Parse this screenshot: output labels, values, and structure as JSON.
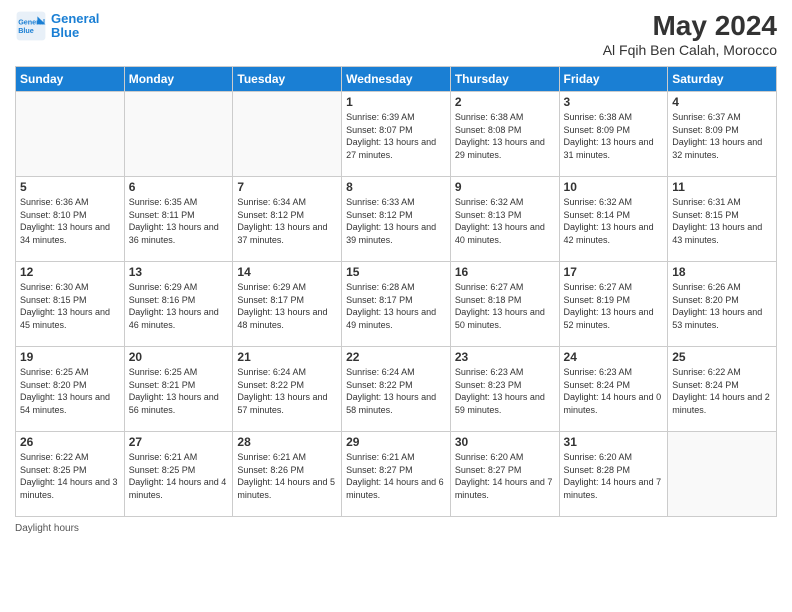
{
  "header": {
    "logo_line1": "General",
    "logo_line2": "Blue",
    "month_year": "May 2024",
    "location": "Al Fqih Ben Calah, Morocco"
  },
  "weekdays": [
    "Sunday",
    "Monday",
    "Tuesday",
    "Wednesday",
    "Thursday",
    "Friday",
    "Saturday"
  ],
  "weeks": [
    [
      {
        "day": "",
        "info": ""
      },
      {
        "day": "",
        "info": ""
      },
      {
        "day": "",
        "info": ""
      },
      {
        "day": "1",
        "info": "Sunrise: 6:39 AM\nSunset: 8:07 PM\nDaylight: 13 hours\nand 27 minutes."
      },
      {
        "day": "2",
        "info": "Sunrise: 6:38 AM\nSunset: 8:08 PM\nDaylight: 13 hours\nand 29 minutes."
      },
      {
        "day": "3",
        "info": "Sunrise: 6:38 AM\nSunset: 8:09 PM\nDaylight: 13 hours\nand 31 minutes."
      },
      {
        "day": "4",
        "info": "Sunrise: 6:37 AM\nSunset: 8:09 PM\nDaylight: 13 hours\nand 32 minutes."
      }
    ],
    [
      {
        "day": "5",
        "info": "Sunrise: 6:36 AM\nSunset: 8:10 PM\nDaylight: 13 hours\nand 34 minutes."
      },
      {
        "day": "6",
        "info": "Sunrise: 6:35 AM\nSunset: 8:11 PM\nDaylight: 13 hours\nand 36 minutes."
      },
      {
        "day": "7",
        "info": "Sunrise: 6:34 AM\nSunset: 8:12 PM\nDaylight: 13 hours\nand 37 minutes."
      },
      {
        "day": "8",
        "info": "Sunrise: 6:33 AM\nSunset: 8:12 PM\nDaylight: 13 hours\nand 39 minutes."
      },
      {
        "day": "9",
        "info": "Sunrise: 6:32 AM\nSunset: 8:13 PM\nDaylight: 13 hours\nand 40 minutes."
      },
      {
        "day": "10",
        "info": "Sunrise: 6:32 AM\nSunset: 8:14 PM\nDaylight: 13 hours\nand 42 minutes."
      },
      {
        "day": "11",
        "info": "Sunrise: 6:31 AM\nSunset: 8:15 PM\nDaylight: 13 hours\nand 43 minutes."
      }
    ],
    [
      {
        "day": "12",
        "info": "Sunrise: 6:30 AM\nSunset: 8:15 PM\nDaylight: 13 hours\nand 45 minutes."
      },
      {
        "day": "13",
        "info": "Sunrise: 6:29 AM\nSunset: 8:16 PM\nDaylight: 13 hours\nand 46 minutes."
      },
      {
        "day": "14",
        "info": "Sunrise: 6:29 AM\nSunset: 8:17 PM\nDaylight: 13 hours\nand 48 minutes."
      },
      {
        "day": "15",
        "info": "Sunrise: 6:28 AM\nSunset: 8:17 PM\nDaylight: 13 hours\nand 49 minutes."
      },
      {
        "day": "16",
        "info": "Sunrise: 6:27 AM\nSunset: 8:18 PM\nDaylight: 13 hours\nand 50 minutes."
      },
      {
        "day": "17",
        "info": "Sunrise: 6:27 AM\nSunset: 8:19 PM\nDaylight: 13 hours\nand 52 minutes."
      },
      {
        "day": "18",
        "info": "Sunrise: 6:26 AM\nSunset: 8:20 PM\nDaylight: 13 hours\nand 53 minutes."
      }
    ],
    [
      {
        "day": "19",
        "info": "Sunrise: 6:25 AM\nSunset: 8:20 PM\nDaylight: 13 hours\nand 54 minutes."
      },
      {
        "day": "20",
        "info": "Sunrise: 6:25 AM\nSunset: 8:21 PM\nDaylight: 13 hours\nand 56 minutes."
      },
      {
        "day": "21",
        "info": "Sunrise: 6:24 AM\nSunset: 8:22 PM\nDaylight: 13 hours\nand 57 minutes."
      },
      {
        "day": "22",
        "info": "Sunrise: 6:24 AM\nSunset: 8:22 PM\nDaylight: 13 hours\nand 58 minutes."
      },
      {
        "day": "23",
        "info": "Sunrise: 6:23 AM\nSunset: 8:23 PM\nDaylight: 13 hours\nand 59 minutes."
      },
      {
        "day": "24",
        "info": "Sunrise: 6:23 AM\nSunset: 8:24 PM\nDaylight: 14 hours\nand 0 minutes."
      },
      {
        "day": "25",
        "info": "Sunrise: 6:22 AM\nSunset: 8:24 PM\nDaylight: 14 hours\nand 2 minutes."
      }
    ],
    [
      {
        "day": "26",
        "info": "Sunrise: 6:22 AM\nSunset: 8:25 PM\nDaylight: 14 hours\nand 3 minutes."
      },
      {
        "day": "27",
        "info": "Sunrise: 6:21 AM\nSunset: 8:25 PM\nDaylight: 14 hours\nand 4 minutes."
      },
      {
        "day": "28",
        "info": "Sunrise: 6:21 AM\nSunset: 8:26 PM\nDaylight: 14 hours\nand 5 minutes."
      },
      {
        "day": "29",
        "info": "Sunrise: 6:21 AM\nSunset: 8:27 PM\nDaylight: 14 hours\nand 6 minutes."
      },
      {
        "day": "30",
        "info": "Sunrise: 6:20 AM\nSunset: 8:27 PM\nDaylight: 14 hours\nand 7 minutes."
      },
      {
        "day": "31",
        "info": "Sunrise: 6:20 AM\nSunset: 8:28 PM\nDaylight: 14 hours\nand 7 minutes."
      },
      {
        "day": "",
        "info": ""
      }
    ]
  ],
  "footer": {
    "daylight_hours": "Daylight hours"
  }
}
